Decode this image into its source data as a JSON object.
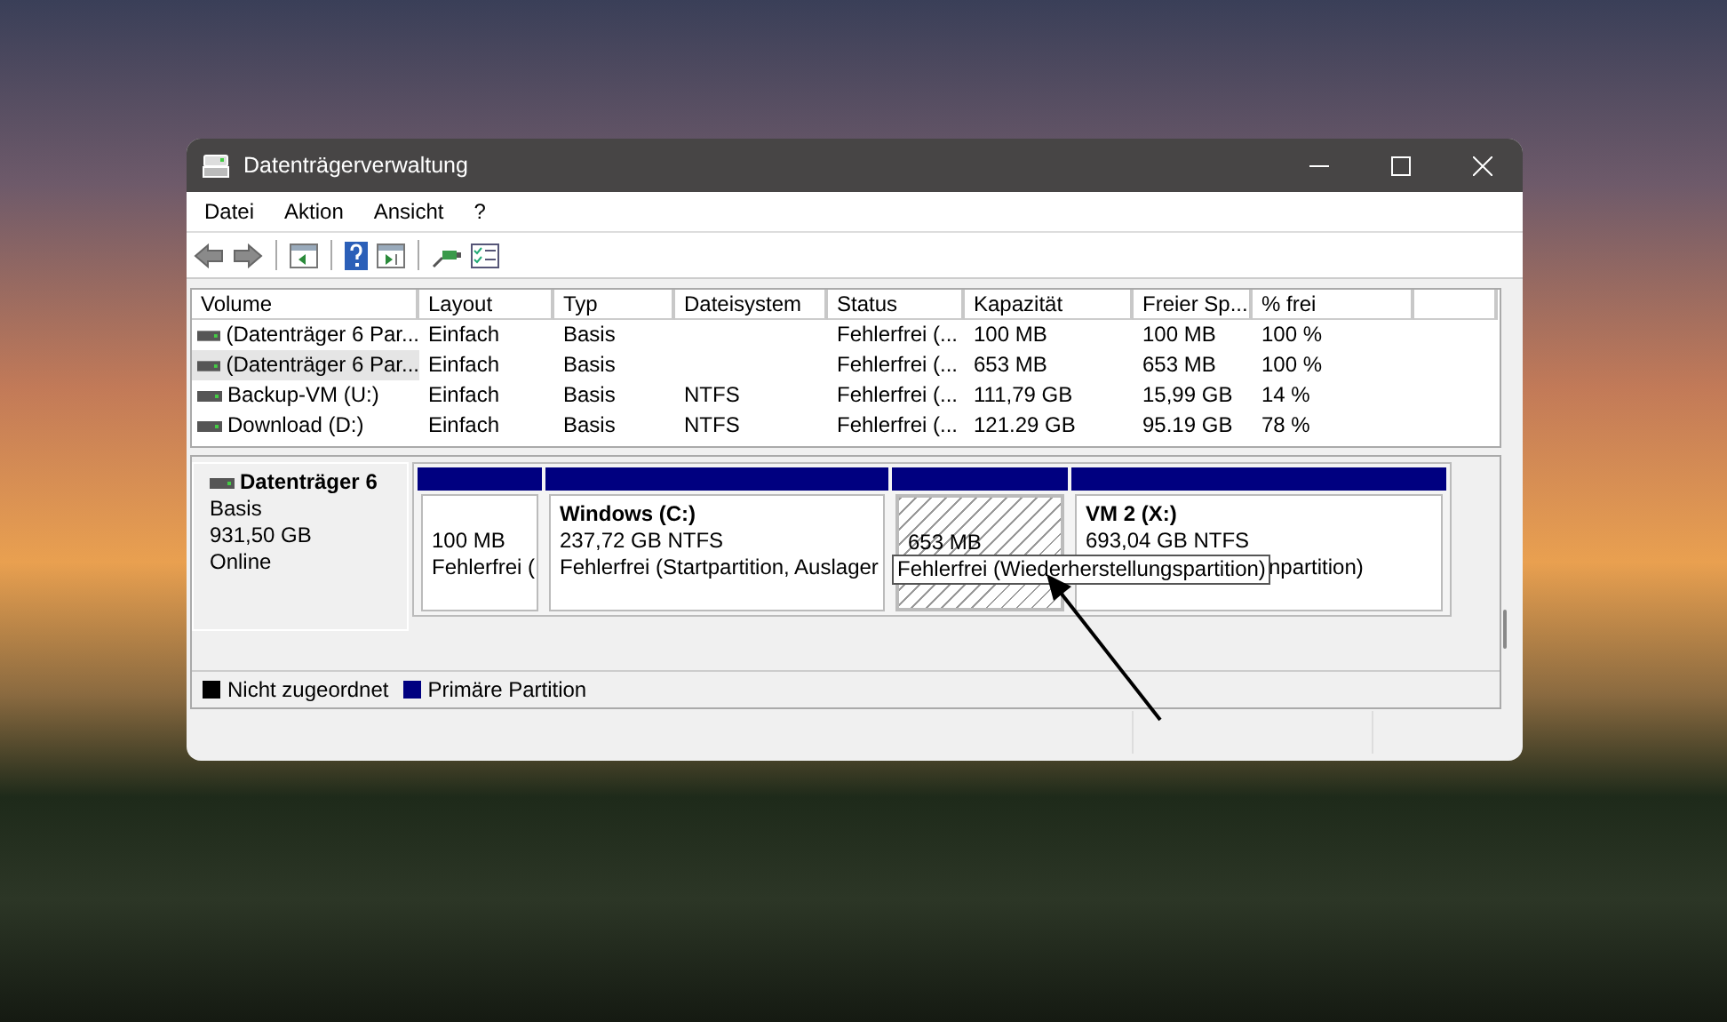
{
  "window": {
    "title": "Datenträgerverwaltung"
  },
  "menu": [
    "Datei",
    "Aktion",
    "Ansicht",
    "?"
  ],
  "toolbar": [
    {
      "kind": "back"
    },
    {
      "kind": "forward"
    },
    {
      "kind": "sep"
    },
    {
      "kind": "pane"
    },
    {
      "kind": "sep"
    },
    {
      "kind": "help"
    },
    {
      "kind": "pane2"
    },
    {
      "kind": "sep"
    },
    {
      "kind": "connect"
    },
    {
      "kind": "list"
    }
  ],
  "table": {
    "columns": [
      "Volume",
      "Layout",
      "Typ",
      "Dateisystem",
      "Status",
      "Kapazität",
      "Freier Sp...",
      "% frei"
    ],
    "rows": [
      {
        "selected": false,
        "cells": [
          "(Datenträger 6 Par...",
          "Einfach",
          "Basis",
          "",
          "Fehlerfrei (...",
          "100 MB",
          "100 MB",
          "100 %"
        ]
      },
      {
        "selected": true,
        "cells": [
          "(Datenträger 6 Par...",
          "Einfach",
          "Basis",
          "",
          "Fehlerfrei (...",
          "653 MB",
          "653 MB",
          "100 %"
        ]
      },
      {
        "selected": false,
        "cells": [
          "Backup-VM (U:)",
          "Einfach",
          "Basis",
          "NTFS",
          "Fehlerfrei (...",
          "111,79 GB",
          "15,99 GB",
          "14 %"
        ]
      },
      {
        "selected": false,
        "cells": [
          "Download (D:)",
          "Einfach",
          "Basis",
          "NTFS",
          "Fehlerfrei (...",
          "121.29 GB",
          "95.19 GB",
          "78 %"
        ]
      }
    ]
  },
  "disk": {
    "name": "Datenträger 6",
    "type": "Basis",
    "size": "931,50 GB",
    "state": "Online",
    "partitions": [
      {
        "selected": false,
        "lines": [
          "100 MB",
          "Fehlerfrei ("
        ]
      },
      {
        "selected": false,
        "title": "Windows  (C:)",
        "lines": [
          "237,72 GB NTFS",
          "Fehlerfrei (Startpartition, Auslager"
        ]
      },
      {
        "selected": true,
        "lines": [
          "653 MB"
        ]
      },
      {
        "selected": false,
        "title": "VM 2  (X:)",
        "lines": [
          "693,04 GB NTFS",
          "npartition)"
        ]
      }
    ]
  },
  "tooltip": "Fehlerfrei (Wiederherstellungspartition)",
  "legend": [
    {
      "label": "Nicht zugeordnet",
      "color": "#000000"
    },
    {
      "label": "Primäre Partition",
      "color": "#000080"
    }
  ]
}
